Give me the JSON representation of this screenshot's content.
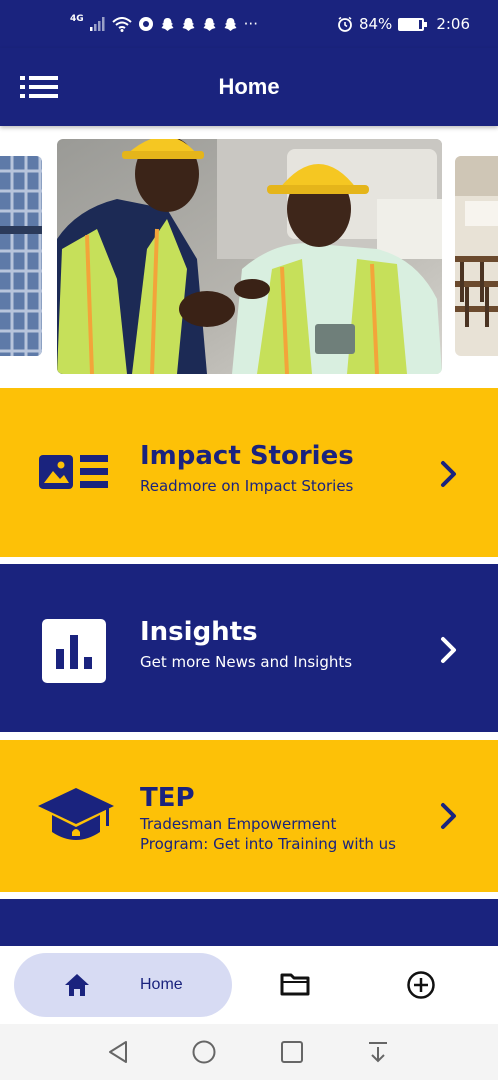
{
  "status_bar": {
    "network": "4G",
    "battery": "84%",
    "battery_level": 0.84,
    "time": "2:06",
    "more": "···"
  },
  "app_bar": {
    "title": "Home",
    "menu_icon": "list-menu-icon"
  },
  "carousel": {
    "slides": [
      {
        "icon": "photo-plaid-shirt"
      },
      {
        "icon": "photo-workers-handshake"
      },
      {
        "icon": "photo-classroom"
      }
    ]
  },
  "cards": [
    {
      "title": "Impact Stories",
      "subtitle": "Readmore on Impact Stories",
      "icon": "article-image-icon",
      "color": "#fdc107"
    },
    {
      "title": "Insights",
      "subtitle": "Get more News and Insights",
      "icon": "bar-chart-icon",
      "color": "#1a237e"
    },
    {
      "title": "TEP",
      "subtitle_line1": "Tradesman Empowerment",
      "subtitle_line2": "Program: Get into Training with us",
      "icon": "graduation-cap-icon",
      "color": "#fdc107"
    }
  ],
  "bottom_nav": {
    "home_label": "Home",
    "home_icon": "home-icon",
    "folder_icon": "folder-icon",
    "add_icon": "add-circle-icon"
  },
  "system_nav": {
    "back": "back-icon",
    "home": "home-circle-icon",
    "recents": "recents-square-icon",
    "notifications": "pull-down-icon"
  },
  "colors": {
    "navy": "#1a237e",
    "yellow": "#fdc107",
    "nav_highlight": "#d7dbf3"
  }
}
